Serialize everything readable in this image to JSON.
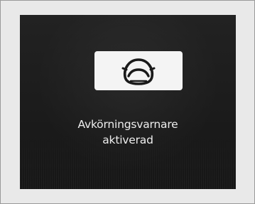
{
  "warning_screen": {
    "icon": "road-departure-mitigation-icon",
    "message_line_1": "Avkörningsvarnare",
    "message_line_2": "aktiverad"
  }
}
